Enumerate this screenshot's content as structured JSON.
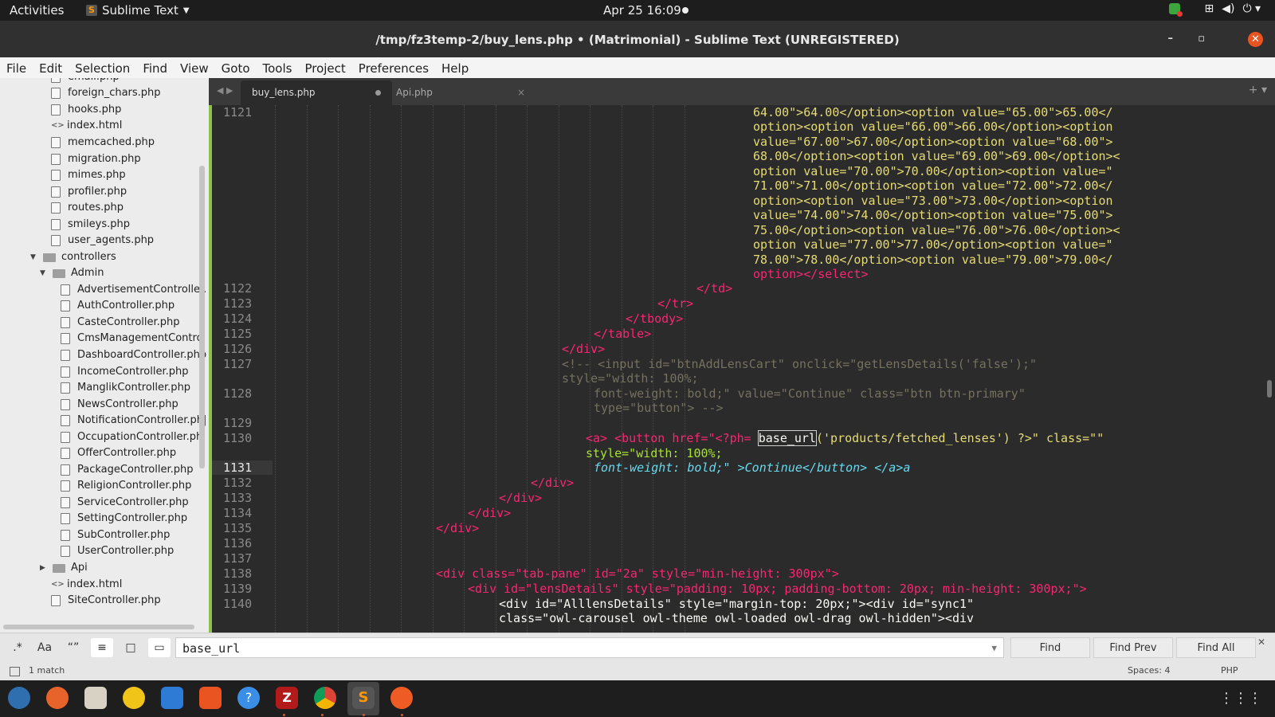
{
  "topbar": {
    "activities": "Activities",
    "app_name": "Sublime Text",
    "datetime": "Apr 25  16:09"
  },
  "window": {
    "title": "/tmp/fz3temp-2/buy_lens.php • (Matrimonial) - Sublime Text (UNREGISTERED)"
  },
  "menu": [
    "File",
    "Edit",
    "Selection",
    "Find",
    "View",
    "Goto",
    "Tools",
    "Project",
    "Preferences",
    "Help"
  ],
  "sidebar": {
    "items": [
      {
        "label": "email.php",
        "type": "file"
      },
      {
        "label": "foreign_chars.php",
        "type": "file"
      },
      {
        "label": "hooks.php",
        "type": "file"
      },
      {
        "label": "index.html",
        "type": "html"
      },
      {
        "label": "memcached.php",
        "type": "file"
      },
      {
        "label": "migration.php",
        "type": "file"
      },
      {
        "label": "mimes.php",
        "type": "file"
      },
      {
        "label": "profiler.php",
        "type": "file"
      },
      {
        "label": "routes.php",
        "type": "file"
      },
      {
        "label": "smileys.php",
        "type": "file"
      },
      {
        "label": "user_agents.php",
        "type": "file"
      },
      {
        "label": "controllers",
        "type": "folder-open"
      },
      {
        "label": "Admin",
        "type": "folder-open"
      },
      {
        "label": "AdvertisementController.",
        "type": "file"
      },
      {
        "label": "AuthController.php",
        "type": "file"
      },
      {
        "label": "CasteController.php",
        "type": "file"
      },
      {
        "label": "CmsManagementControl",
        "type": "file"
      },
      {
        "label": "DashboardController.php",
        "type": "file"
      },
      {
        "label": "IncomeController.php",
        "type": "file"
      },
      {
        "label": "ManglikController.php",
        "type": "file"
      },
      {
        "label": "NewsController.php",
        "type": "file"
      },
      {
        "label": "NotificationController.ph|",
        "type": "file"
      },
      {
        "label": "OccupationController.ph|",
        "type": "file"
      },
      {
        "label": "OfferController.php",
        "type": "file"
      },
      {
        "label": "PackageController.php",
        "type": "file"
      },
      {
        "label": "ReligionController.php",
        "type": "file"
      },
      {
        "label": "ServiceController.php",
        "type": "file"
      },
      {
        "label": "SettingController.php",
        "type": "file"
      },
      {
        "label": "SubController.php",
        "type": "file"
      },
      {
        "label": "UserController.php",
        "type": "file"
      },
      {
        "label": "Api",
        "type": "folder-closed"
      },
      {
        "label": "index.html",
        "type": "html"
      },
      {
        "label": "SiteController.php",
        "type": "file"
      }
    ]
  },
  "tabs": [
    {
      "label": "buy_lens.php",
      "active": true,
      "modified": true
    },
    {
      "label": "Api.php",
      "active": false,
      "modified": false
    }
  ],
  "editor": {
    "line_numbers": [
      "1121",
      "1122",
      "1123",
      "1124",
      "1125",
      "1126",
      "1127",
      "1128",
      "1129",
      "1130",
      "1131",
      "1132",
      "1133",
      "1134",
      "1135",
      "1136",
      "1137",
      "1138",
      "1139",
      "1140"
    ],
    "current_line": "1131",
    "lines": {
      "l1121_a": "64.00\">64.00</option><option value=\"65.00\">65.00</",
      "l1121_b": "option><option value=\"66.00\">66.00</option><option",
      "l1121_c": "value=\"67.00\">67.00</option><option value=\"68.00\">",
      "l1121_d": "68.00</option><option value=\"69.00\">69.00</option><",
      "l1121_e": "option value=\"70.00\">70.00</option><option value=\"",
      "l1121_f": "71.00\">71.00</option><option value=\"72.00\">72.00</",
      "l1121_g": "option><option value=\"73.00\">73.00</option><option",
      "l1121_h": "value=\"74.00\">74.00</option><option value=\"75.00\">",
      "l1121_i": "75.00</option><option value=\"76.00\">76.00</option><",
      "l1121_j": "option value=\"77.00\">77.00</option><option value=\"",
      "l1121_k": "78.00\">78.00</option><option value=\"79.00\">79.00</",
      "l1121_l": "option></select>",
      "l1122": "</td>",
      "l1123": "</tr>",
      "l1124": "</tbody>",
      "l1125": "</table>",
      "l1126": "</div>",
      "l1127_a": "<!-- <input id=\"btnAddLensCart\" onclick=\"getLensDetails('false');\"",
      "l1127_b": "style=\"width: 100%;",
      "l1128_a": "font-weight: bold;\" value=\"Continue\" class=\"btn btn-primary\"",
      "l1128_b": "type=\"button\"> -->",
      "l1130_pre": "<a> <button href=\"<?ph= ",
      "l1130_match": "base_url",
      "l1130_post": "('products/fetched_lenses') ?>\" class=\"\"",
      "l1130_b": "style=\"width: 100%;",
      "l1131": "font-weight: bold;\" >Continue</button> </a>a",
      "l1132": "</div>",
      "l1133": "</div>",
      "l1134": "</div>",
      "l1135": "</div>",
      "l1138": "<div class=\"tab-pane\" id=\"2a\" style=\"min-height: 300px\">",
      "l1139": "<div id=\"lensDetails\" style=\"padding: 10px; padding-bottom: 20px; min-height: 300px;\">",
      "l1140_a": "<div id=\"AlllensDetails\" style=\"margin-top: 20px;\"><div id=\"sync1\"",
      "l1140_b": "class=\"owl-carousel owl-theme owl-loaded owl-drag owl-hidden\"><div"
    }
  },
  "find": {
    "query": "base_url",
    "options": [
      ".*",
      "Aa",
      "“”",
      "≡",
      "□",
      "▭"
    ],
    "find_label": "Find",
    "find_prev_label": "Find Prev",
    "find_all_label": "Find All"
  },
  "status": {
    "matches": "1 match",
    "indent": "Spaces: 4",
    "syntax": "PHP"
  },
  "colors": {
    "accent": "#e95420",
    "modified_gutter": "#8bc34a",
    "tag": "#f92672",
    "attr": "#a6e22e",
    "string": "#e6db74",
    "comment": "#75715e",
    "number": "#ae81ff"
  },
  "taskbar": [
    "thunderbird-icon",
    "firefox-icon",
    "files-icon",
    "rhythmbox-icon",
    "writer-icon",
    "software-center-icon",
    "help-icon",
    "filezilla-icon",
    "chrome-icon",
    "sublime-icon",
    "postman-icon",
    "apps-grid-icon"
  ]
}
